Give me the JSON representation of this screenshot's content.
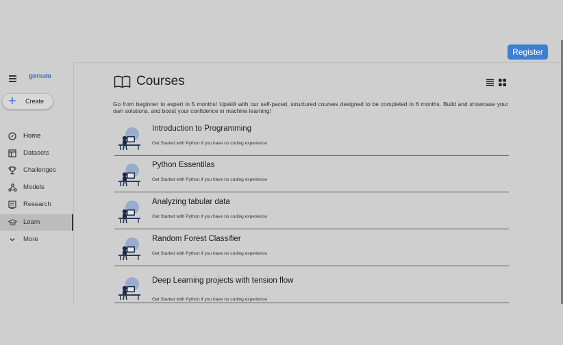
{
  "header": {
    "register_label": "Register"
  },
  "sidebar": {
    "logo": "genum",
    "create_label": "Create",
    "items": [
      {
        "label": "Home",
        "icon": "compass-icon",
        "active": false
      },
      {
        "label": "Datasets",
        "icon": "table-icon",
        "active": false
      },
      {
        "label": "Challenges",
        "icon": "trophy-icon",
        "active": false
      },
      {
        "label": "Models",
        "icon": "network-icon",
        "active": false
      },
      {
        "label": "Research",
        "icon": "document-icon",
        "active": false
      },
      {
        "label": "Learn",
        "icon": "graduation-cap-icon",
        "active": true
      },
      {
        "label": "More",
        "icon": "chevron-down-icon",
        "active": false
      }
    ]
  },
  "main": {
    "title": "Courses",
    "description": "Go from beginner to expert in 5 months! Upskill with our self-paced, structured courses designed to be completed in 6 months. Build and showcase your own solutions, and boost your confidence in machine learning!",
    "courses": [
      {
        "title": "Introduction to Programming",
        "subtitle": "Get Started with Python if you have no coding experience"
      },
      {
        "title": "Python Essentilas",
        "subtitle": "Get Started with Python if you have no coding experience"
      },
      {
        "title": "Analyzing tabular data",
        "subtitle": "Get Started with Python if you have no coding experience"
      },
      {
        "title": "Random Forest Classifier",
        "subtitle": "Get Started with Python if you have no coding experience"
      },
      {
        "title": "Deep Learning projects with tension flow",
        "subtitle": "Get Started with Python if you have no coding experience"
      }
    ]
  },
  "colors": {
    "accent": "#3d7fd0",
    "background": "#cfcfcf",
    "active_nav": "#bcbcbc"
  }
}
